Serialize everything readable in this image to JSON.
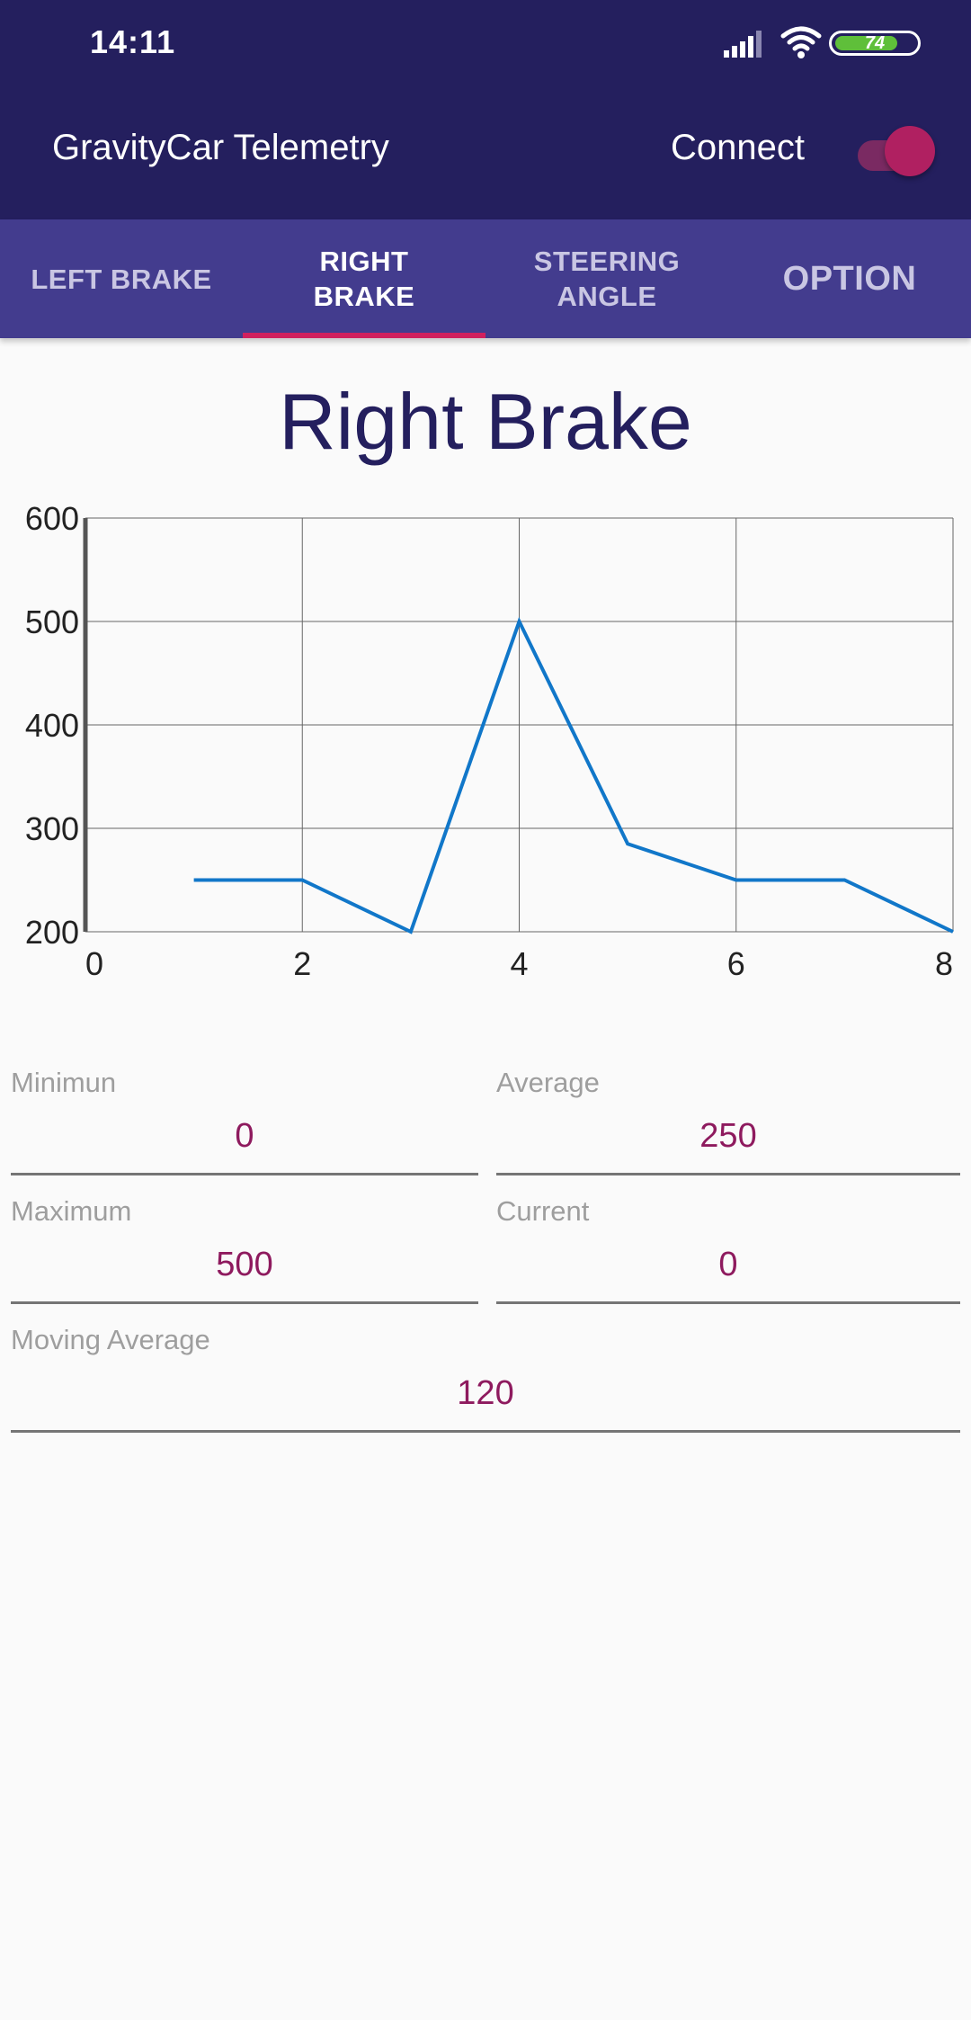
{
  "status_bar": {
    "time": "14:11",
    "battery": "74"
  },
  "toolbar": {
    "title": "GravityCar Telemetry",
    "connect_label": "Connect",
    "connect_on": true
  },
  "tabs": [
    {
      "label": "LEFT BRAKE",
      "active": false
    },
    {
      "label": "RIGHT\nBRAKE",
      "active": true
    },
    {
      "label": "STEERING\nANGLE",
      "active": false
    },
    {
      "label": "OPTION",
      "active": false
    }
  ],
  "page_title": "Right Brake",
  "chart_data": {
    "type": "line",
    "title": "",
    "xlabel": "",
    "ylabel": "",
    "xlim": [
      0,
      8
    ],
    "ylim": [
      200,
      600
    ],
    "x_ticks": [
      "0",
      "2",
      "4",
      "6",
      "8"
    ],
    "y_ticks": [
      "200",
      "300",
      "400",
      "500",
      "600"
    ],
    "grid": true,
    "series": [
      {
        "color": "#1177c9",
        "x": [
          1,
          2,
          3,
          4,
          5,
          6,
          7,
          8
        ],
        "y": [
          250,
          250,
          200,
          500,
          285,
          250,
          250,
          200
        ]
      }
    ]
  },
  "fields": {
    "minimum": {
      "label": "Minimun",
      "value": "0"
    },
    "average": {
      "label": "Average",
      "value": "250"
    },
    "maximum": {
      "label": "Maximum",
      "value": "500"
    },
    "current": {
      "label": "Current",
      "value": "0"
    },
    "moving_average": {
      "label": "Moving Average",
      "value": "120"
    }
  },
  "colors": {
    "primary": "#241f5e",
    "tab_bar": "#433c8e",
    "accent": "#b02061",
    "value_text": "#8e1a5e",
    "chart_line": "#1177c9"
  }
}
